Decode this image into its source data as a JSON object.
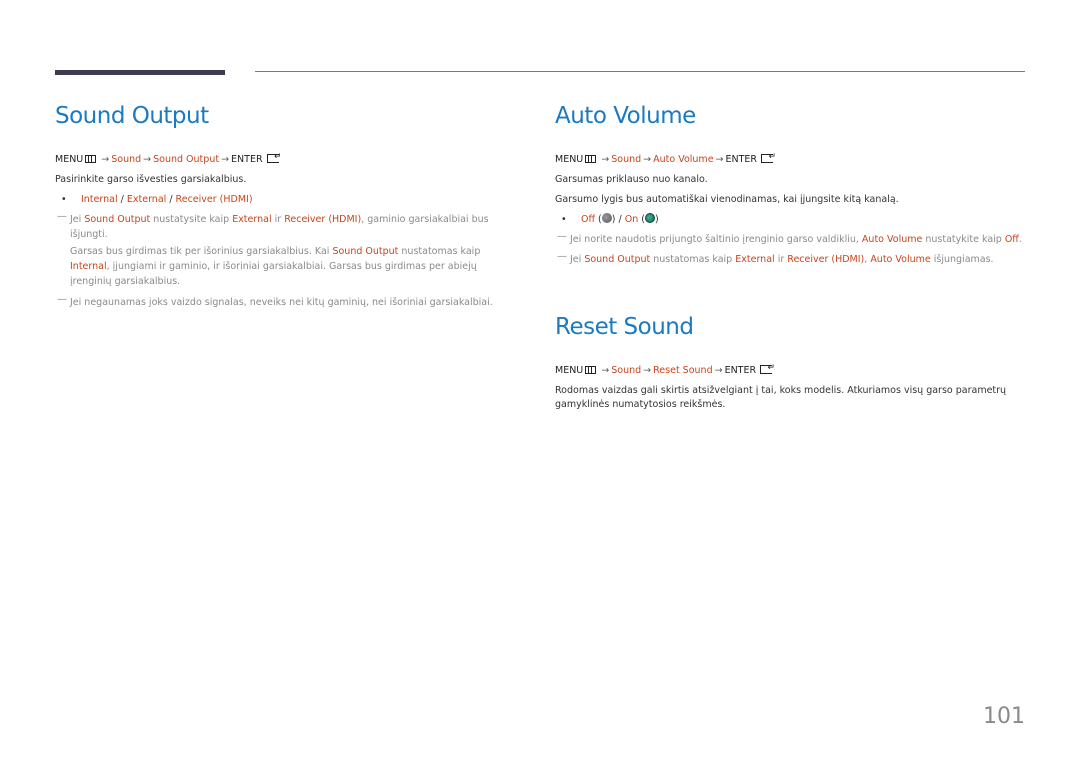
{
  "page_number": "101",
  "colors": {
    "title": "#1a7ac2",
    "highlight": "#c8451c",
    "note_text": "#8a8a8a",
    "toggle_on": "#1f8a72",
    "toggle_off": "#777777"
  },
  "sound_output": {
    "title": "Sound Output",
    "path": {
      "menu": "MENU",
      "menu_icon": "menu-icon",
      "arrow": "→",
      "sound": "Sound",
      "item": "Sound Output",
      "enter": "ENTER",
      "enter_icon": "enter-icon"
    },
    "description": "Pasirinkite garso išvesties garsiakalbius.",
    "options": [
      "Internal",
      "External",
      "Receiver (HDMI)"
    ],
    "options_separator": " / ",
    "note1": {
      "a": "Jei ",
      "b": "Sound Output",
      "c": " nustatysite kaip ",
      "d": "External",
      "e": " ir ",
      "f": "Receiver (HDMI)",
      "g": ", gaminio garsiakalbiai bus išjungti."
    },
    "note1_cont": {
      "a": "Garsas bus girdimas tik per išorinius garsiakalbius. Kai ",
      "b": "Sound Output",
      "c": " nustatomas kaip ",
      "d": "Internal",
      "e": ", įjungiami ir gaminio, ir išoriniai garsiakalbiai. Garsas bus girdimas per abiejų įrenginių garsiakalbius."
    },
    "note2": "Jei negaunamas joks vaizdo signalas, neveiks nei kitų gaminių, nei išoriniai garsiakalbiai."
  },
  "auto_volume": {
    "title": "Auto Volume",
    "path": {
      "menu": "MENU",
      "arrow": "→",
      "sound": "Sound",
      "item": "Auto Volume",
      "enter": "ENTER"
    },
    "description1": "Garsumas priklauso nuo kanalo.",
    "description2": "Garsumo lygis bus automatiškai vienodinamas, kai įjungsite kitą kanalą.",
    "options": {
      "off": "Off",
      "on": "On",
      "off_icon": "toggle-off-icon",
      "on_icon": "toggle-on-icon"
    },
    "note1": {
      "a": "Jei norite naudotis prijungto šaltinio įrenginio garso valdikliu, ",
      "b": "Auto Volume",
      "c": " nustatykite kaip ",
      "d": "Off",
      "e": "."
    },
    "note2": {
      "a": "Jei ",
      "b": "Sound Output",
      "c": " nustatomas kaip ",
      "d": "External",
      "e": " ir ",
      "f": "Receiver (HDMI)",
      "g": ", ",
      "h": "Auto Volume",
      "i": " išjungiamas."
    }
  },
  "reset_sound": {
    "title": "Reset Sound",
    "path": {
      "menu": "MENU",
      "arrow": "→",
      "sound": "Sound",
      "item": "Reset Sound",
      "enter": "ENTER"
    },
    "description": "Rodomas vaizdas gali skirtis atsižvelgiant į tai, koks modelis. Atkuriamos visų garso parametrų gamyklinės numatytosios reikšmės."
  }
}
